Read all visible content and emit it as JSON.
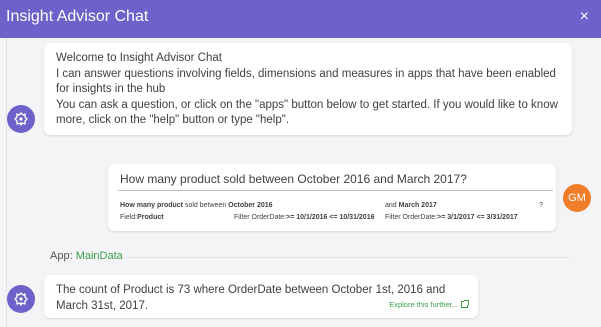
{
  "header": {
    "title": "Insight Advisor Chat",
    "close_glyph": "×"
  },
  "welcome": {
    "lines": [
      "Welcome to Insight Advisor Chat",
      "I can answer questions involving fields, dimensions and measures in apps that have been enabled for insights in the hub",
      "You can ask a question, or click on the \"apps\" button below to get started. If you would like to know more, click on the \"help\" button or type \"help\"."
    ]
  },
  "user_message": {
    "avatar_initials": "GM",
    "question": "How many product sold between October 2016 and March 2017?",
    "interpretation": {
      "row1": {
        "how_many": "How many product",
        "sold_between": " sold between ",
        "from": "October 2016",
        "and_label": "and ",
        "to": "March 2017",
        "qmark": "?"
      },
      "row2": {
        "field_label": "Field:",
        "field_value": "Product",
        "filter1_label": "Filter OrderDate:",
        "filter1_value": ">= 10/1/2016 <= 10/31/2016",
        "filter2_label": "Filter OrderDate:",
        "filter2_value": ">= 3/1/2017 <= 3/31/2017"
      }
    }
  },
  "app": {
    "label": "App: ",
    "name": "MainData"
  },
  "answer": {
    "text": "The count of Product is 73 where OrderDate between October 1st, 2016 and March 31st, 2017.",
    "explore_label": "Explore this further..."
  },
  "colors": {
    "header_bg": "#6e61c9",
    "bot_avatar": "#6e61c9",
    "user_avatar": "#ef7d2a",
    "link_green": "#3b9f4a"
  },
  "icons": {
    "bot_avatar": "bot-insight-icon",
    "explore": "external-link-icon"
  }
}
